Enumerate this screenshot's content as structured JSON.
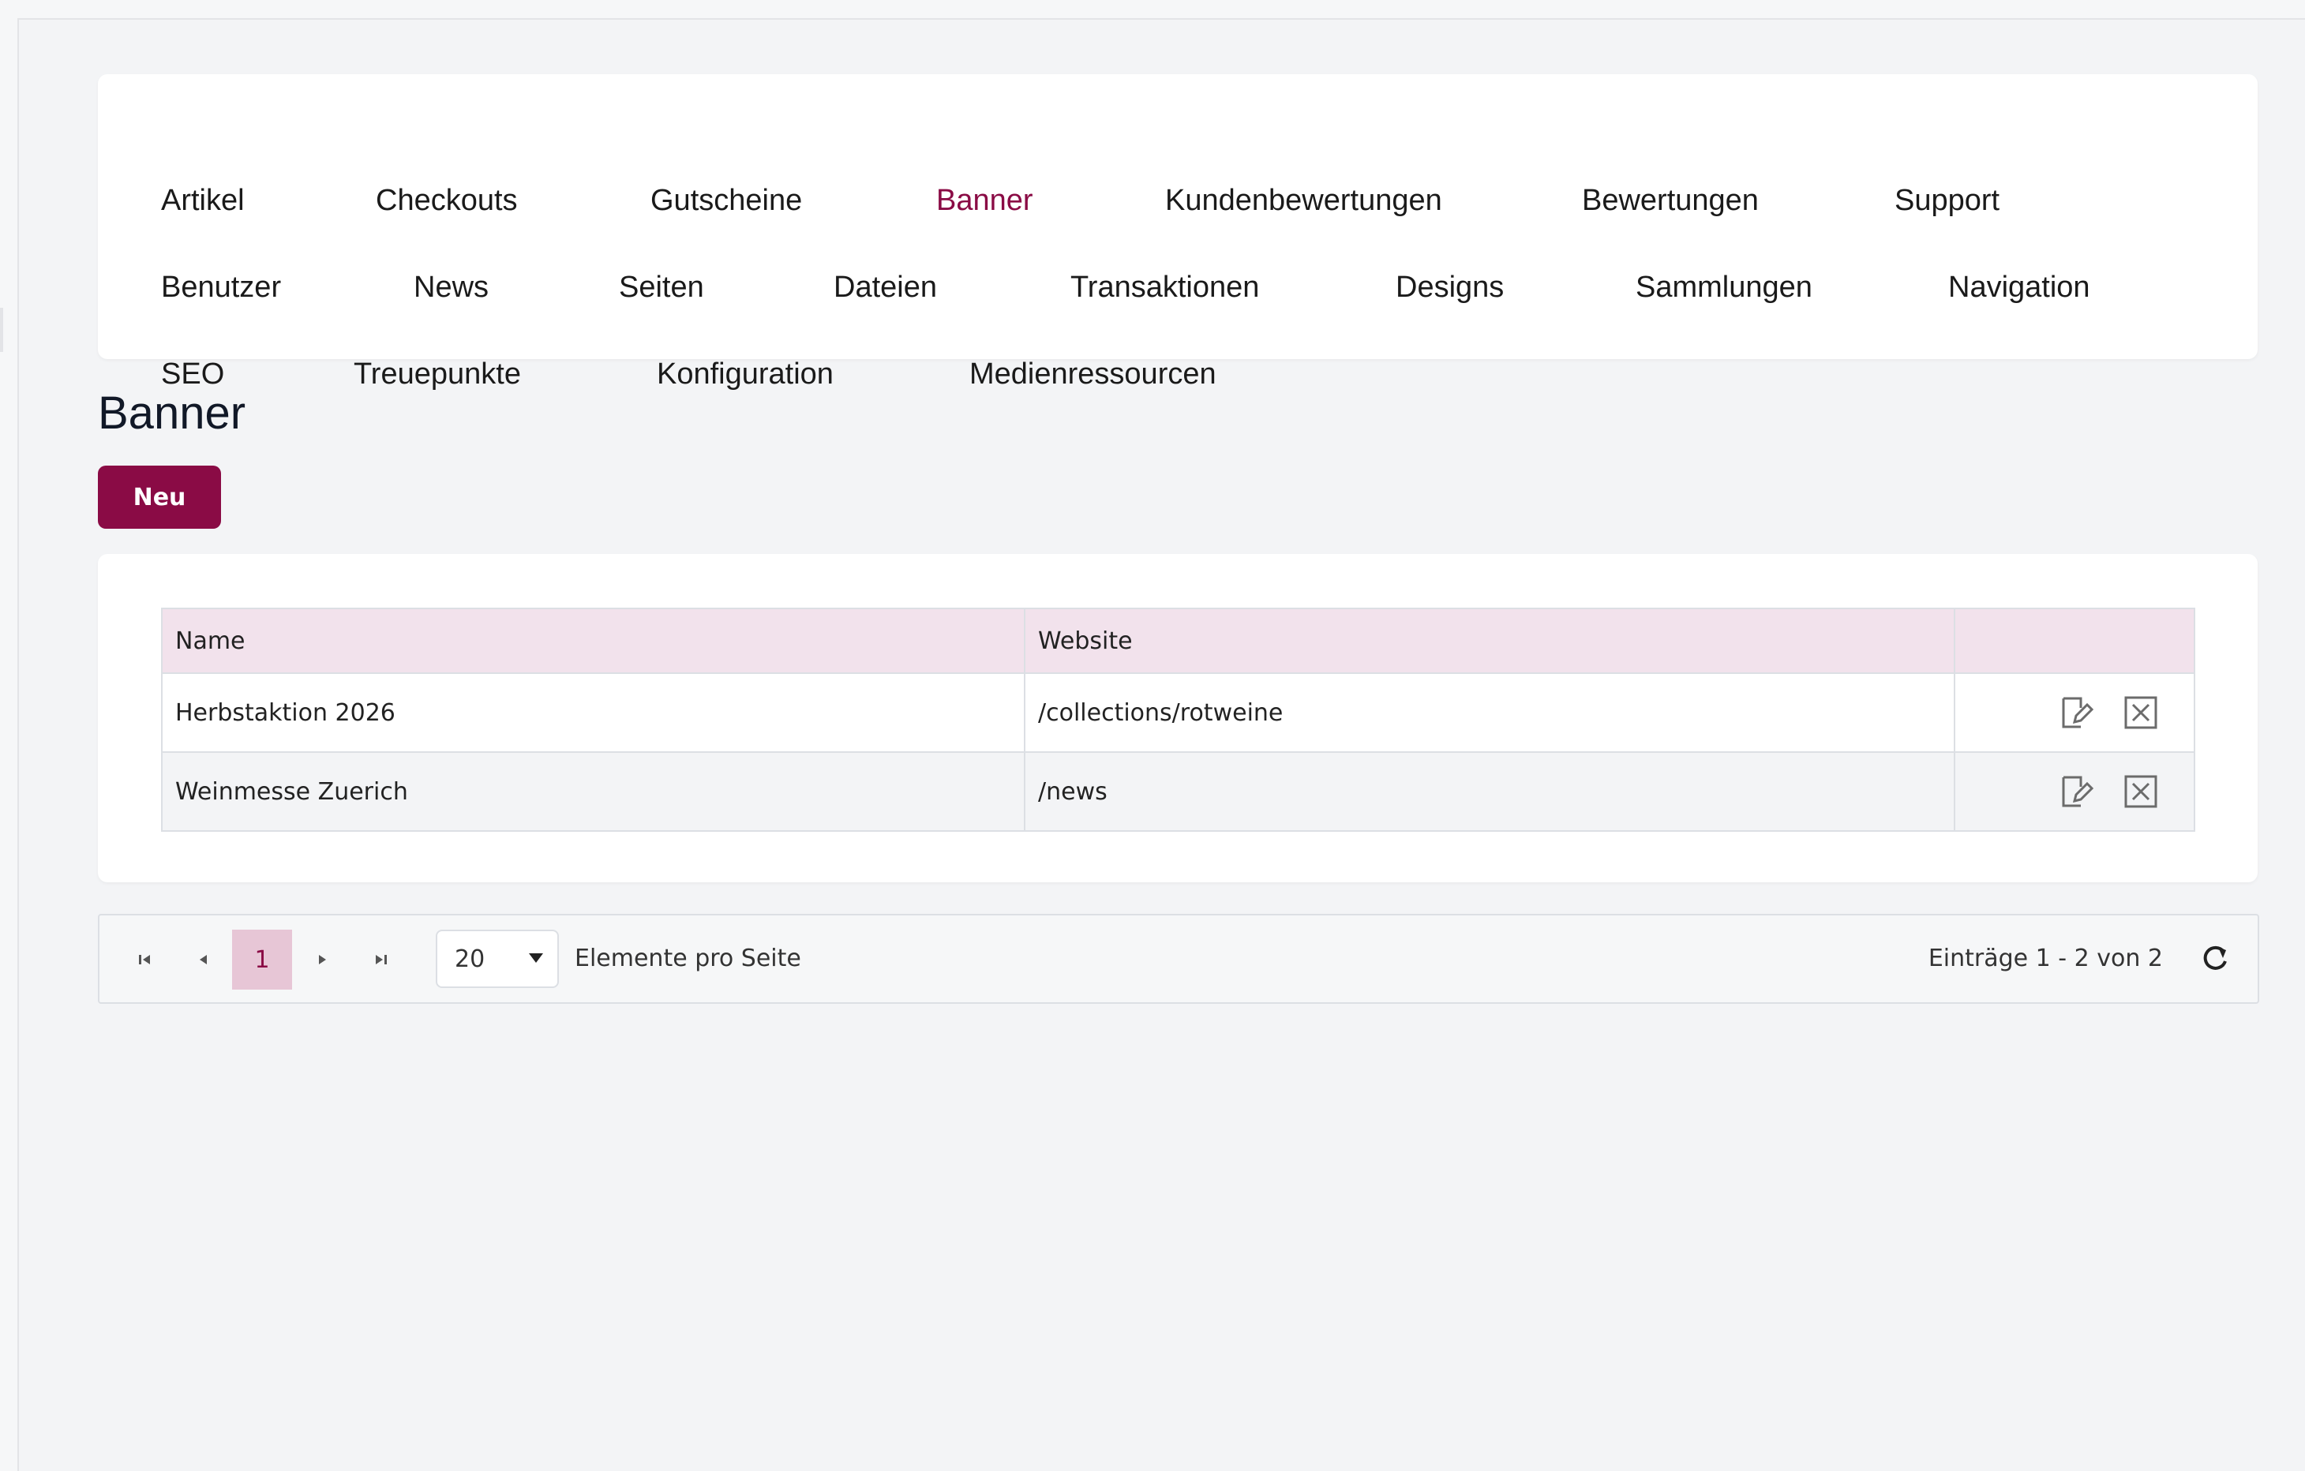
{
  "nav": {
    "row1": [
      "Artikel",
      "Checkouts",
      "Gutscheine",
      "Banner",
      "Kundenbewertungen",
      "Bewertungen",
      "Support"
    ],
    "row2": [
      "Benutzer",
      "News",
      "Seiten",
      "Dateien",
      "Transaktionen",
      "Designs",
      "Sammlungen",
      "Navigation"
    ],
    "row3": [
      "SEO",
      "Treuepunkte",
      "Konfiguration",
      "Medienressourcen"
    ],
    "active": "Banner"
  },
  "page": {
    "title": "Banner",
    "new_label": "Neu"
  },
  "table": {
    "headers": [
      "Name",
      "Website",
      ""
    ],
    "rows": [
      {
        "name": "Herbstaktion 2026",
        "website": "/collections/rotweine"
      },
      {
        "name": "Weinmesse Zuerich",
        "website": "/news"
      }
    ]
  },
  "pager": {
    "current_page": "1",
    "page_size": "20",
    "per_page_label": "Elemente pro Seite",
    "entries_label": "Einträge 1 - 2 von 2"
  },
  "colors": {
    "accent": "#8a0b45",
    "header_bg": "#f2e2ec",
    "page_bg": "#f3f4f6"
  },
  "icons": [
    "first-page-icon",
    "prev-page-icon",
    "next-page-icon",
    "last-page-icon",
    "edit-icon",
    "delete-icon",
    "refresh-icon",
    "dropdown-caret-icon"
  ]
}
